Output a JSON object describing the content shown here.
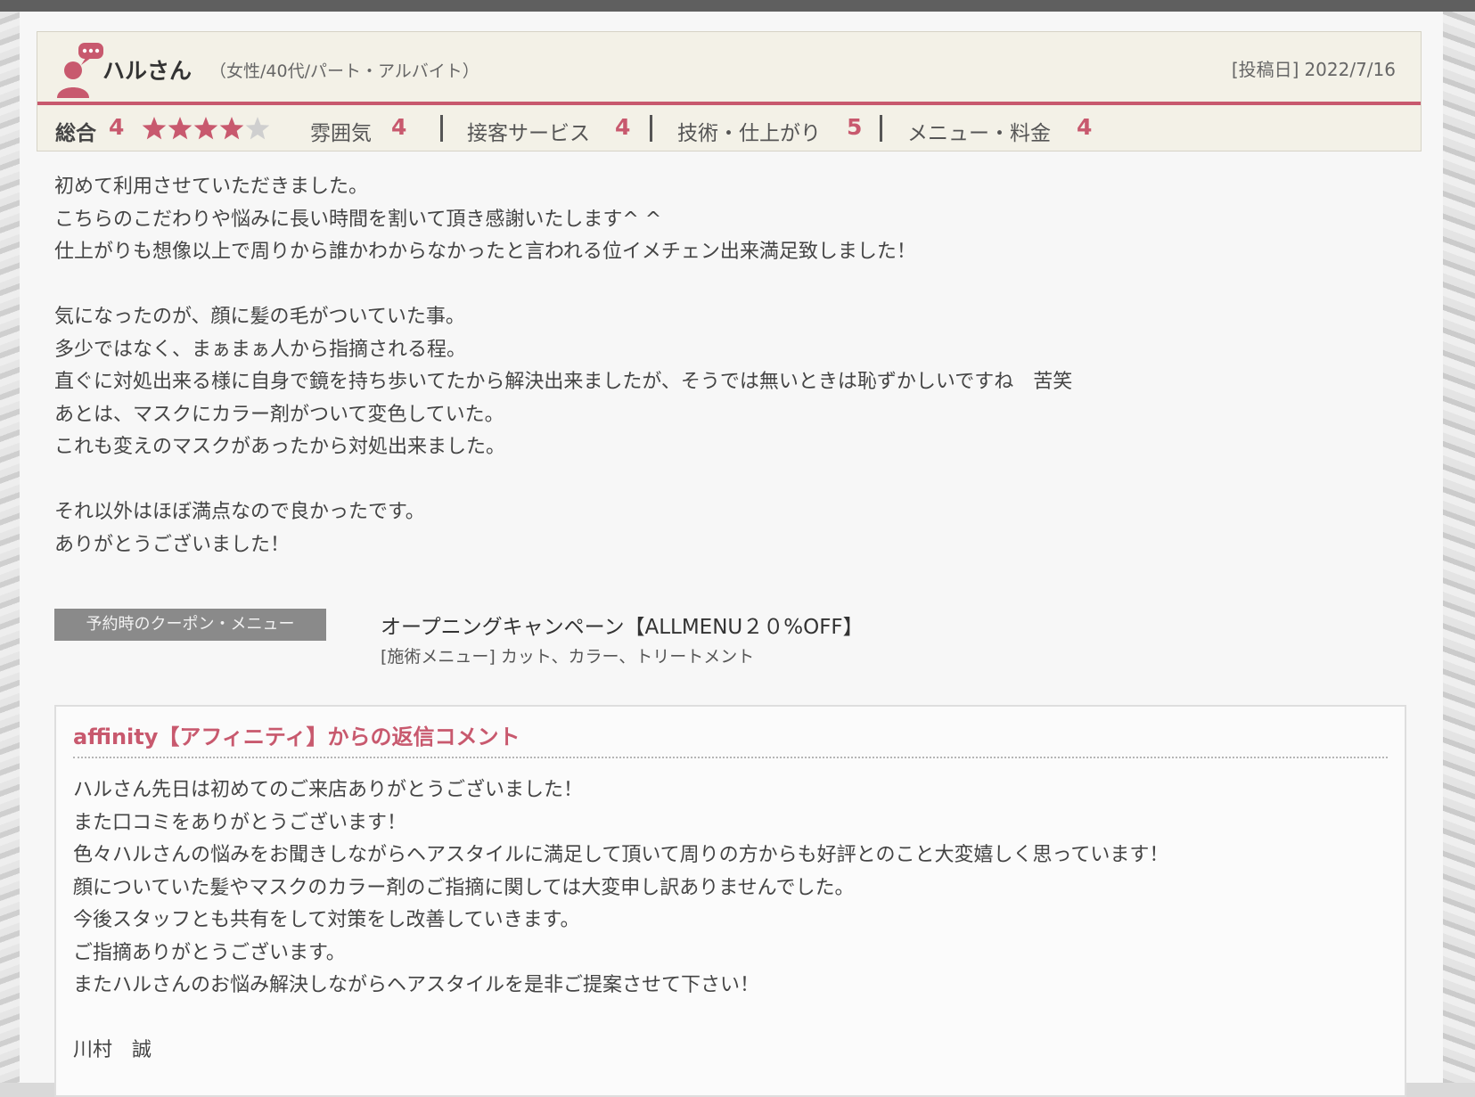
{
  "review": {
    "user_name": "ハルさん",
    "user_meta": "（女性/40代/パート・アルバイト）",
    "date_label": "[投稿日]",
    "date": "2022/7/16",
    "ratings": {
      "overall_label": "総合",
      "overall_value": "4",
      "overall_stars": 4,
      "items": [
        {
          "label": "雰囲気",
          "value": "4"
        },
        {
          "label": "接客サービス",
          "value": "4"
        },
        {
          "label": "技術・仕上がり",
          "value": "5"
        },
        {
          "label": "メニュー・料金",
          "value": "4"
        }
      ]
    },
    "body_lines": [
      "初めて利用させていただきました。",
      "こちらのこだわりや悩みに長い時間を割いて頂き感謝いたします^ ^",
      "仕上がりも想像以上で周りから誰かわからなかったと言われる位イメチェン出来満足致しました！",
      "",
      "気になったのが、顔に髪の毛がついていた事。",
      "多少ではなく、まぁまぁ人から指摘される程。",
      "直ぐに対処出来る様に自身で鏡を持ち歩いてたから解決出来ましたが、そうでは無いときは恥ずかしいですね　苦笑",
      "あとは、マスクにカラー剤がついて変色していた。",
      "これも変えのマスクがあったから対処出来ました。",
      "",
      "それ以外はほぼ満点なので良かったです。",
      "ありがとうございました！"
    ]
  },
  "coupon": {
    "label": "予約時のクーポン・メニュー",
    "title": "オープニングキャンペーン【ALLMENU２０%OFF】",
    "menu": "[施術メニュー] カット、カラー、トリートメント"
  },
  "reply": {
    "title": "affinity【アフィニティ】からの返信コメント",
    "body_lines": [
      "ハルさん先日は初めてのご来店ありがとうございました！",
      "また口コミをありがとうございます！",
      "色々ハルさんの悩みをお聞きしながらヘアスタイルに満足して頂いて周りの方からも好評とのこと大変嬉しく思っています！",
      "顔についていた髪やマスクのカラー剤のご指摘に関しては大変申し訳ありませんでした。",
      "今後スタッフとも共有をして対策をし改善していきます。",
      "ご指摘ありがとうございます。",
      "またハルさんのお悩み解決しながらヘアスタイルを是非ご提案させて下さい！",
      "",
      "川村　誠"
    ]
  },
  "colors": {
    "accent": "#c8596e",
    "header_bg": "#f3f1e7",
    "coupon_bg": "#8a8a8a"
  },
  "icons": {
    "user": "user-comment-icon",
    "star": "star-icon"
  }
}
